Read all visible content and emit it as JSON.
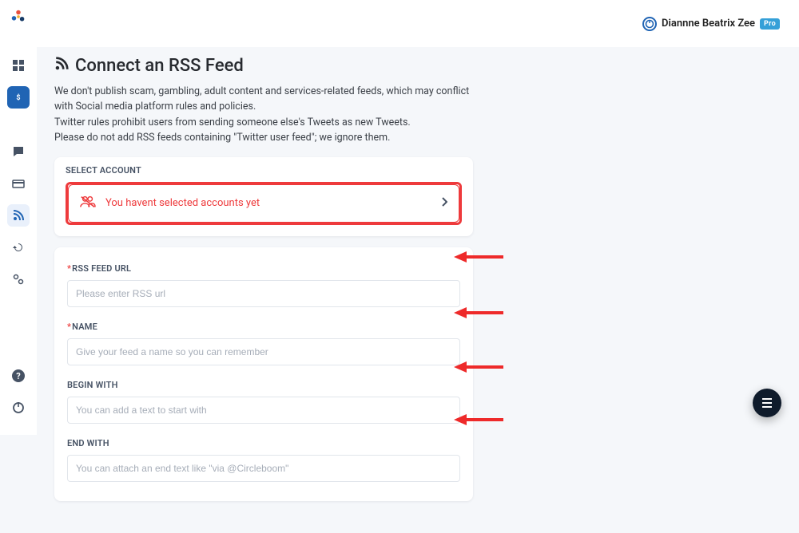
{
  "header": {
    "user_name": "Diannne Beatrix Zee",
    "badge": "Pro"
  },
  "page": {
    "title": "Connect an RSS Feed",
    "disclaimer_line1": "We don't publish scam, gambling, adult content and services-related feeds, which may conflict with Social media platform rules and policies.",
    "disclaimer_line2": "Twitter rules prohibit users from sending someone else's Tweets as new Tweets.",
    "disclaimer_line3": "Please do not add RSS feeds containing \"Twitter user feed\"; we ignore them."
  },
  "select_account": {
    "heading": "SELECT ACCOUNT",
    "empty_text": "You havent selected accounts yet"
  },
  "form": {
    "rss_url": {
      "label": "RSS FEED URL",
      "placeholder": "Please enter RSS url",
      "value": ""
    },
    "name": {
      "label": "NAME",
      "placeholder": "Give your feed a name so you can remember",
      "value": ""
    },
    "begin": {
      "label": "BEGIN WITH",
      "placeholder": "You can add a text to start with",
      "value": ""
    },
    "end": {
      "label": "END WITH",
      "placeholder": "You can attach an end text like \"via @Circleboom\"",
      "value": ""
    }
  },
  "sidebar": {
    "items": [
      "dashboard",
      "monetize",
      "chat",
      "card",
      "rss",
      "history",
      "settings"
    ]
  }
}
